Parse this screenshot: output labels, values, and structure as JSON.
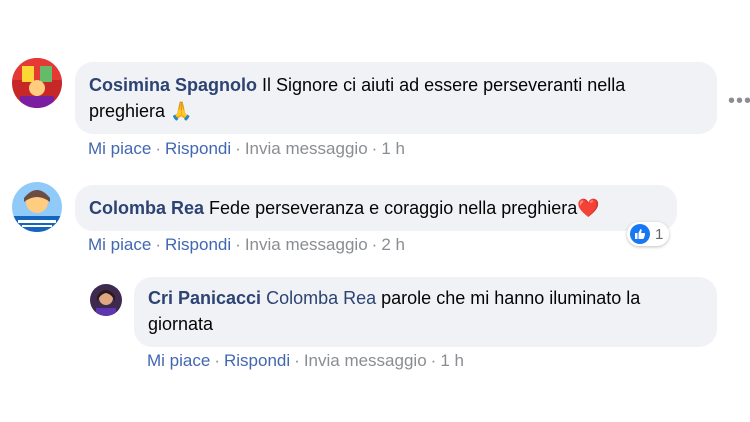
{
  "comments": [
    {
      "author": "Cosimina Spagnolo",
      "text": "Il Signore ci aiuti ad essere perseveranti nella preghiera",
      "emoji": "🙏",
      "actions": {
        "like": "Mi piace",
        "reply": "Rispondi",
        "message": "Invia messaggio",
        "time": "1 h"
      }
    },
    {
      "author": "Colomba Rea",
      "text": "Fede perseveranza e coraggio nella preghiera",
      "emoji": "❤️",
      "reaction_count": "1",
      "actions": {
        "like": "Mi piace",
        "reply": "Rispondi",
        "message": "Invia messaggio",
        "time": "2 h"
      }
    },
    {
      "author": "Cri Panicacci",
      "mention": "Colomba Rea",
      "text_line1": "parole che mi hanno iluminato la",
      "text_line2": "giornata",
      "actions": {
        "like": "Mi piace",
        "reply": "Rispondi",
        "message": "Invia messaggio",
        "time": "1 h"
      }
    }
  ],
  "separator": "·",
  "more_icon": "•••",
  "colors": {
    "link": "#4267b2",
    "author": "#2d4373",
    "bubble": "#f0f2f5",
    "meta": "#8a8d91",
    "like_blue": "#1877f2"
  }
}
